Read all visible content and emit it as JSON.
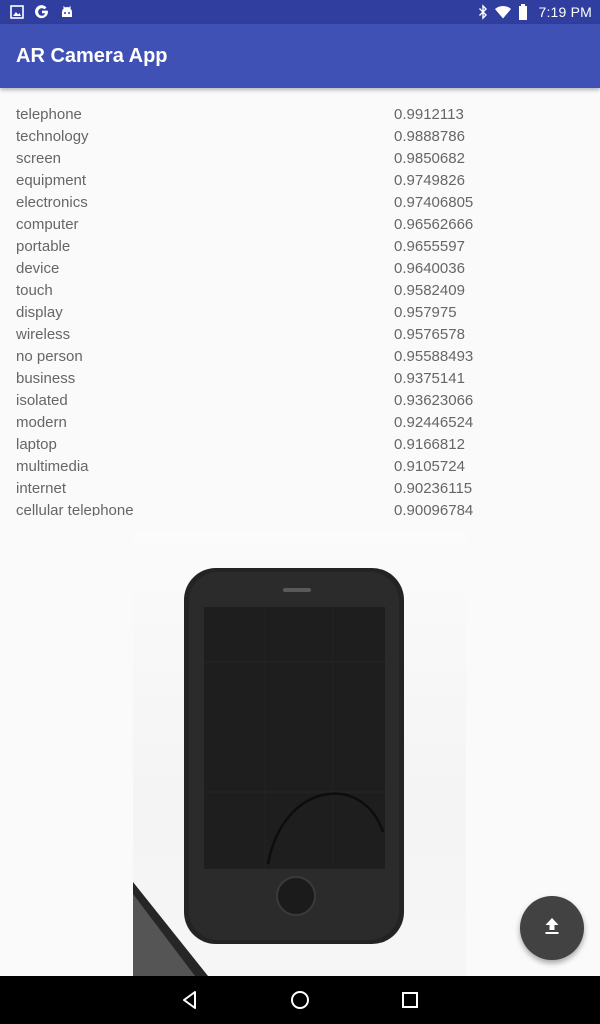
{
  "status_bar": {
    "time": "7:19 PM",
    "left_icons": [
      "image-icon",
      "google-icon",
      "android-icon"
    ],
    "right_icons": [
      "bluetooth-icon",
      "wifi-icon",
      "battery-icon"
    ]
  },
  "app_bar": {
    "title": "AR Camera App"
  },
  "results": [
    {
      "label": "telephone",
      "score": "0.9912113"
    },
    {
      "label": "technology",
      "score": "0.9888786"
    },
    {
      "label": "screen",
      "score": "0.9850682"
    },
    {
      "label": "equipment",
      "score": "0.9749826"
    },
    {
      "label": "electronics",
      "score": "0.97406805"
    },
    {
      "label": "computer",
      "score": "0.96562666"
    },
    {
      "label": "portable",
      "score": "0.9655597"
    },
    {
      "label": "device",
      "score": "0.9640036"
    },
    {
      "label": "touch",
      "score": "0.9582409"
    },
    {
      "label": "display",
      "score": "0.957975"
    },
    {
      "label": "wireless",
      "score": "0.9576578"
    },
    {
      "label": "no person",
      "score": "0.95588493"
    },
    {
      "label": "business",
      "score": "0.9375141"
    },
    {
      "label": "isolated",
      "score": "0.93623066"
    },
    {
      "label": "modern",
      "score": "0.92446524"
    },
    {
      "label": "laptop",
      "score": "0.9166812"
    },
    {
      "label": "multimedia",
      "score": "0.9105724"
    },
    {
      "label": "internet",
      "score": "0.90236115"
    },
    {
      "label": "cellular telephone",
      "score": "0.90096784"
    }
  ],
  "fab": {
    "icon": "upload-icon"
  },
  "nav_bar": {
    "icons": [
      "back-icon",
      "home-icon",
      "recents-icon"
    ]
  }
}
